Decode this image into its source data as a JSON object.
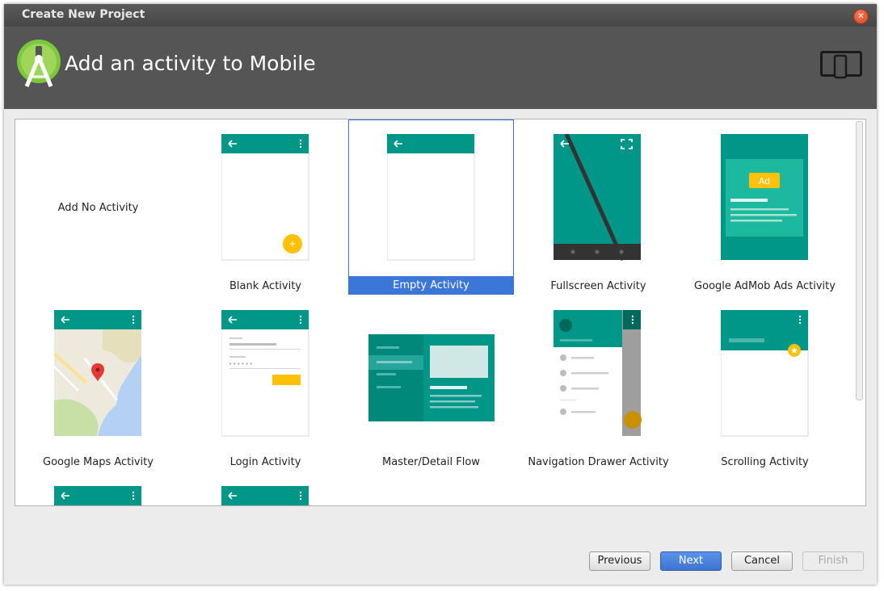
{
  "window": {
    "title": "Create New Project"
  },
  "header": {
    "title": "Add an activity to Mobile"
  },
  "gallery": {
    "items": [
      {
        "label": "Add No Activity"
      },
      {
        "label": "Blank Activity"
      },
      {
        "label": "Empty Activity",
        "selected": true
      },
      {
        "label": "Fullscreen Activity"
      },
      {
        "label": "Google AdMob Ads Activity",
        "badge": "Ad"
      },
      {
        "label": "Google Maps Activity"
      },
      {
        "label": "Login Activity"
      },
      {
        "label": "Master/Detail Flow"
      },
      {
        "label": "Navigation Drawer Activity"
      },
      {
        "label": "Scrolling Activity"
      }
    ]
  },
  "footer": {
    "previous_label": "Previous",
    "next_label": "Next",
    "cancel_label": "Cancel",
    "finish_label": "Finish"
  },
  "colors": {
    "accent": "#009688",
    "selection": "#3c77d8",
    "fab": "#ffc107"
  }
}
